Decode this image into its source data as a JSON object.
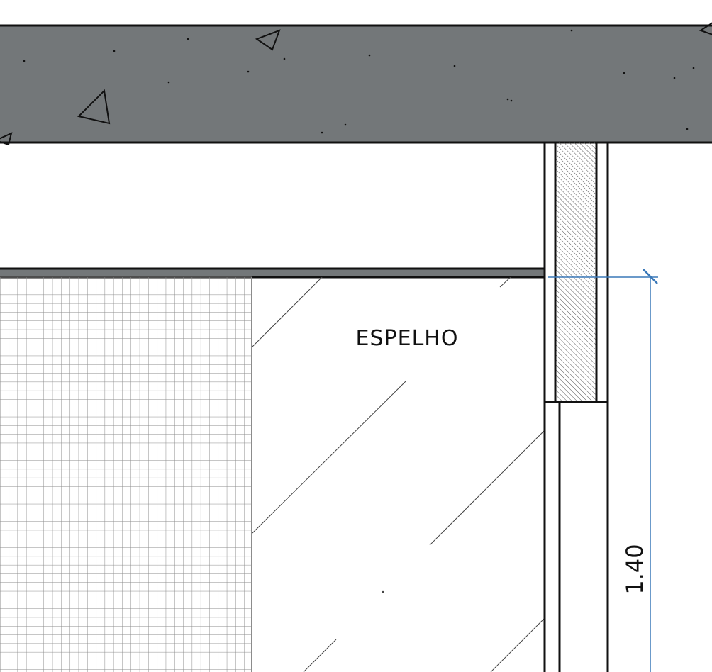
{
  "labels": {
    "mirror": "ESPELHO",
    "dimension": "1.40"
  },
  "colors": {
    "background": "#ffffff",
    "concrete_slab": "#737779",
    "outline": "#111111",
    "tile_grid": "#8c8c8c",
    "dimension_line": "#3a78b8",
    "hatch": "#555555"
  }
}
